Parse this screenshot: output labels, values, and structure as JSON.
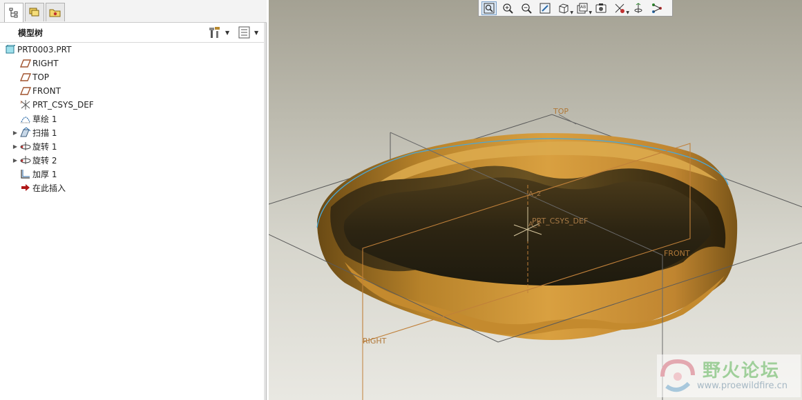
{
  "tabs": [
    {
      "icon": "model-tree-icon"
    },
    {
      "icon": "layers-icon"
    },
    {
      "icon": "favorites-folder-icon"
    }
  ],
  "model_tree": {
    "title": "模型树",
    "settings_icon": "tree-settings-icon",
    "columns_icon": "tree-columns-icon",
    "items": [
      {
        "label": "PRT0003.PRT",
        "icon": "part-icon",
        "expandable": false
      },
      {
        "label": "RIGHT",
        "icon": "datum-plane-icon",
        "expandable": false
      },
      {
        "label": "TOP",
        "icon": "datum-plane-icon",
        "expandable": false
      },
      {
        "label": "FRONT",
        "icon": "datum-plane-icon",
        "expandable": false
      },
      {
        "label": "PRT_CSYS_DEF",
        "icon": "csys-icon",
        "expandable": false
      },
      {
        "label": "草绘 1",
        "icon": "sketch-icon",
        "expandable": false
      },
      {
        "label": "扫描 1",
        "icon": "sweep-icon",
        "expandable": true
      },
      {
        "label": "旋转 1",
        "icon": "revolve-icon",
        "expandable": true
      },
      {
        "label": "旋转 2",
        "icon": "revolve-icon",
        "expandable": true
      },
      {
        "label": "加厚 1",
        "icon": "thicken-icon",
        "expandable": false
      },
      {
        "label": "在此插入",
        "icon": "insert-here-icon",
        "expandable": false
      }
    ]
  },
  "toolbar": {
    "buttons": [
      "refit-icon",
      "zoom-in-icon",
      "zoom-out-icon",
      "repaint-icon",
      "saved-orientations-icon",
      "view-manager-icon",
      "display-style-icon",
      "datum-display-icon",
      "spin-center-icon",
      "annotation-display-icon"
    ]
  },
  "viewport": {
    "labels": {
      "top": "TOP",
      "front": "FRONT",
      "right": "RIGHT",
      "csys": "PRT_CSYS_DEF",
      "axis2": "A_2",
      "axis1": "A_1"
    },
    "colors": {
      "part_gold": "#c48a2e",
      "part_dark": "#2a2212",
      "datum_orange": "#c0803a",
      "datum_gray": "#5a5a5a",
      "highlight_edge": "#4aa8d8"
    }
  },
  "watermark": {
    "title": "野火论坛",
    "url": "www.proewildfire.cn"
  }
}
